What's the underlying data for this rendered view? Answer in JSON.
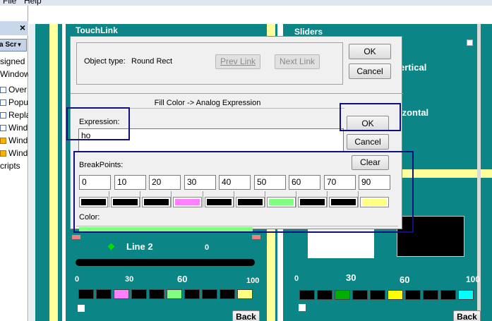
{
  "menubar": {
    "item1": "File",
    "item2": "Help"
  },
  "left_panel": {
    "close": "×",
    "button": "a Scr",
    "items": [
      {
        "label": "signed",
        "check": false
      },
      {
        "label": "Window",
        "check": false
      },
      {
        "label": "Over",
        "check": true,
        "color": "white"
      },
      {
        "label": "Popu",
        "check": true,
        "color": "white"
      },
      {
        "label": "Repla",
        "check": true,
        "color": "white"
      },
      {
        "label": "Wind",
        "check": true,
        "color": "white"
      },
      {
        "label": "Wind",
        "check": true,
        "color": "yellow"
      },
      {
        "label": "Wind",
        "check": true,
        "color": "yellow"
      },
      {
        "label": "cripts",
        "check": false
      }
    ]
  },
  "canvas": {
    "touchlink_title": "TouchLink",
    "sliders_title": "Sliders",
    "vertical_label": "ertical",
    "horizontal_label": "izontal",
    "line2_label": "Line 2",
    "line2_value": "0",
    "left_scale": [
      "0",
      "30",
      "60",
      "100"
    ],
    "right_scale": [
      "0",
      "30",
      "60",
      "100"
    ],
    "back_left": "Back",
    "back_right": "Back",
    "left_bar_colors": [
      "#000000",
      "#000000",
      "#ff80ff",
      "#000000",
      "#000000",
      "#80ff80",
      "#000000",
      "#000000",
      "#000000",
      "#ffff80"
    ],
    "right_bar_colors": [
      "#000000",
      "#000000",
      "#00b000",
      "#000000",
      "#000000",
      "#ffff00",
      "#000000",
      "#000000",
      "#000000",
      "#00ffff"
    ]
  },
  "dialog": {
    "object_type_label": "Object type:",
    "object_type_value": "Round Rect",
    "prev_link": "Prev Link",
    "next_link": "Next Link",
    "ok_top": "OK",
    "cancel_top": "Cancel",
    "section_title": "Fill Color -> Analog Expression",
    "expression_label": "Expression:",
    "expression_value": "ho",
    "ok": "OK",
    "cancel": "Cancel",
    "breakpoints_label": "BreakPoints:",
    "clear": "Clear",
    "breakpoints": [
      "0",
      "10",
      "20",
      "30",
      "40",
      "50",
      "60",
      "70",
      "90"
    ],
    "color_label": "Color:",
    "colors": [
      "#000000",
      "#000000",
      "#000000",
      "#ff80ff",
      "#000000",
      "#000000",
      "#80ff80",
      "#000000",
      "#000000",
      "#ffff80"
    ]
  }
}
